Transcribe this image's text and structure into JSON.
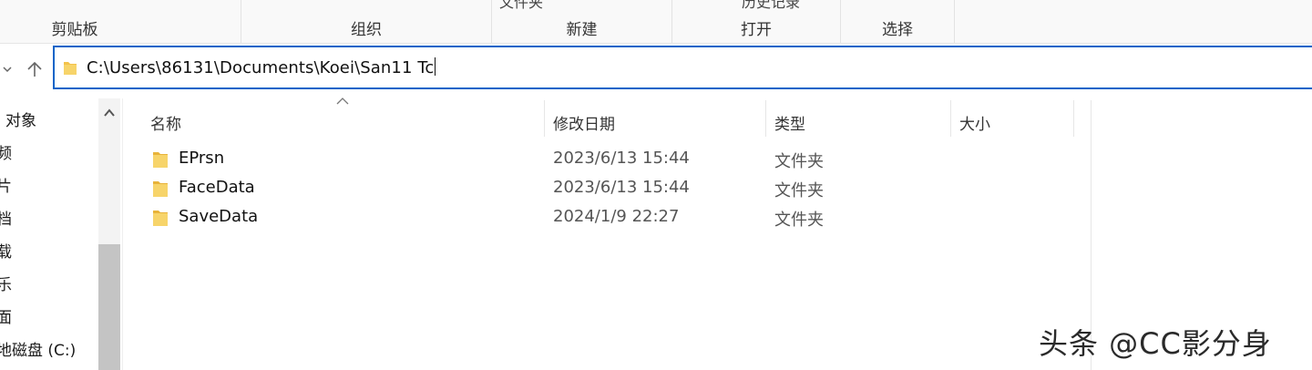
{
  "ribbon": {
    "cut_labels": [
      "文件夹",
      "历史记录"
    ],
    "groups": [
      "剪贴板",
      "组织",
      "新建",
      "打开",
      "选择"
    ]
  },
  "address": {
    "path": "C:\\Users\\86131\\Documents\\Koei\\San11 Tc"
  },
  "nav_pane": {
    "items": [
      "对象",
      "频",
      "片",
      "档",
      "载",
      "乐",
      "面",
      "地磁盘 (C:)"
    ]
  },
  "columns": {
    "name": "名称",
    "date": "修改日期",
    "type": "类型",
    "size": "大小"
  },
  "files": [
    {
      "name": "EPrsn",
      "date": "2023/6/13 15:44",
      "type": "文件夹"
    },
    {
      "name": "FaceData",
      "date": "2023/6/13 15:44",
      "type": "文件夹"
    },
    {
      "name": "SaveData",
      "date": "2024/1/9 22:27",
      "type": "文件夹"
    }
  ],
  "watermark": "头条 @CC影分身",
  "colors": {
    "address_border": "#0a64c8",
    "folder": "#f3c24b",
    "scrollbar_thumb": "#c4c4c4"
  }
}
